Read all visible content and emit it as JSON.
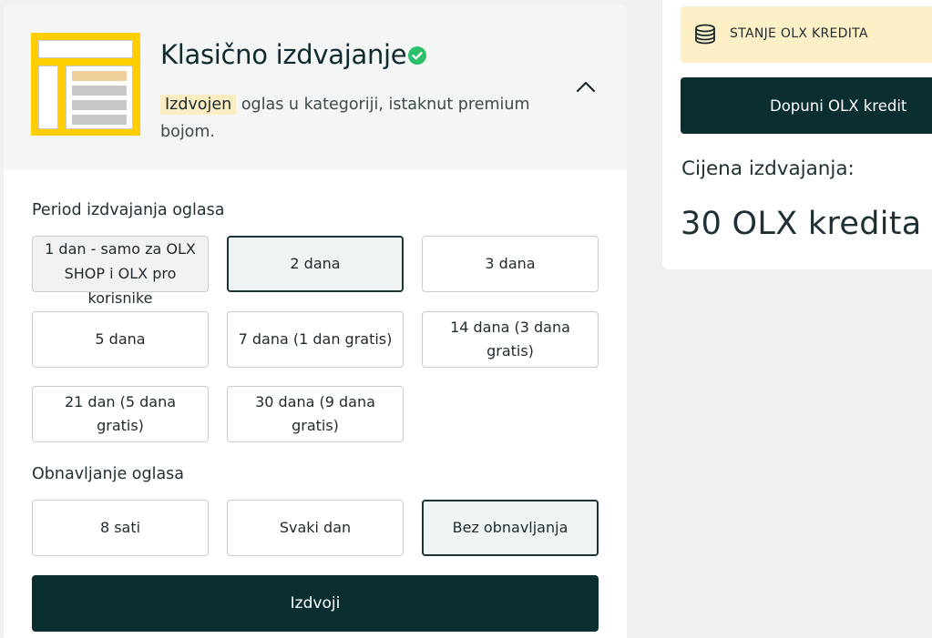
{
  "promo": {
    "title": "Klasično izdvajanje",
    "badge": "Izdvojen",
    "description": "oglas u kategoriji, istaknut premium bojom."
  },
  "period": {
    "label": "Period izdvajanja oglasa",
    "options": [
      "1 dan - samo za OLX SHOP i OLX pro korisnike",
      "2 dana",
      "3 dana",
      "5 dana",
      "7 dana (1 dan gratis)",
      "14 dana (3 dana gratis)",
      "21 dan (5 dana gratis)",
      "30 dana (9 dana gratis)"
    ],
    "selected": "2 dana"
  },
  "renewal": {
    "label": "Obnavljanje oglasa",
    "options": [
      "8 sati",
      "Svaki dan",
      "Bez obnavljanja"
    ],
    "selected": "Bez obnavljanja"
  },
  "cta": {
    "label": "Izdvoji"
  },
  "sidebar": {
    "credit_banner": "STANJE OLX KREDITA",
    "topup_label": "Dopuni OLX kredit",
    "price_label": "Cijena izdvajanja:",
    "price_value": "30 OLX kredita"
  },
  "colors": {
    "accent_dark": "#0b2e30",
    "highlight_yellow": "#ffce00",
    "badge_bg": "#fbecc2",
    "verified_green": "#2cbf6a"
  },
  "icons": [
    "verified-check-icon",
    "chevron-up-icon",
    "coins-stack-icon"
  ]
}
